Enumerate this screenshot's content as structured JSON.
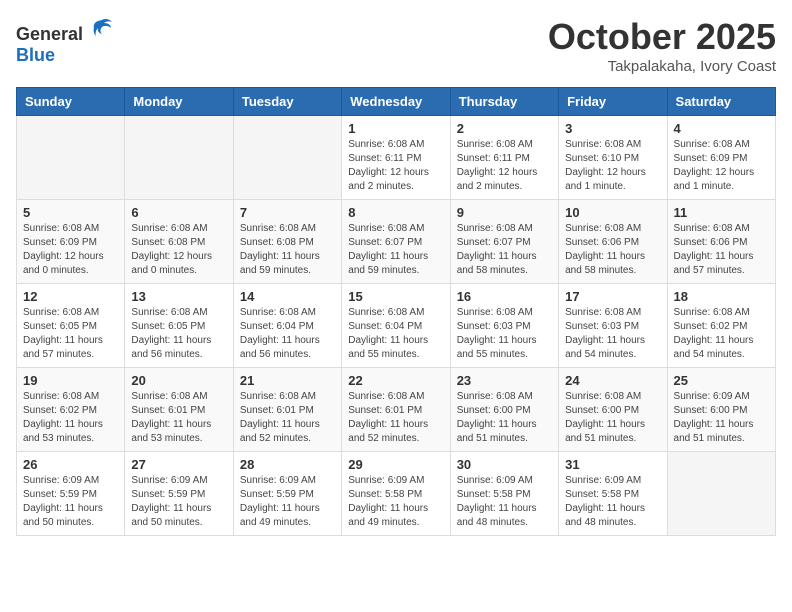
{
  "header": {
    "logo_general": "General",
    "logo_blue": "Blue",
    "month": "October 2025",
    "location": "Takpalakaha, Ivory Coast"
  },
  "weekdays": [
    "Sunday",
    "Monday",
    "Tuesday",
    "Wednesday",
    "Thursday",
    "Friday",
    "Saturday"
  ],
  "weeks": [
    [
      {
        "day": "",
        "info": ""
      },
      {
        "day": "",
        "info": ""
      },
      {
        "day": "",
        "info": ""
      },
      {
        "day": "1",
        "info": "Sunrise: 6:08 AM\nSunset: 6:11 PM\nDaylight: 12 hours and 2 minutes."
      },
      {
        "day": "2",
        "info": "Sunrise: 6:08 AM\nSunset: 6:11 PM\nDaylight: 12 hours and 2 minutes."
      },
      {
        "day": "3",
        "info": "Sunrise: 6:08 AM\nSunset: 6:10 PM\nDaylight: 12 hours and 1 minute."
      },
      {
        "day": "4",
        "info": "Sunrise: 6:08 AM\nSunset: 6:09 PM\nDaylight: 12 hours and 1 minute."
      }
    ],
    [
      {
        "day": "5",
        "info": "Sunrise: 6:08 AM\nSunset: 6:09 PM\nDaylight: 12 hours and 0 minutes."
      },
      {
        "day": "6",
        "info": "Sunrise: 6:08 AM\nSunset: 6:08 PM\nDaylight: 12 hours and 0 minutes."
      },
      {
        "day": "7",
        "info": "Sunrise: 6:08 AM\nSunset: 6:08 PM\nDaylight: 11 hours and 59 minutes."
      },
      {
        "day": "8",
        "info": "Sunrise: 6:08 AM\nSunset: 6:07 PM\nDaylight: 11 hours and 59 minutes."
      },
      {
        "day": "9",
        "info": "Sunrise: 6:08 AM\nSunset: 6:07 PM\nDaylight: 11 hours and 58 minutes."
      },
      {
        "day": "10",
        "info": "Sunrise: 6:08 AM\nSunset: 6:06 PM\nDaylight: 11 hours and 58 minutes."
      },
      {
        "day": "11",
        "info": "Sunrise: 6:08 AM\nSunset: 6:06 PM\nDaylight: 11 hours and 57 minutes."
      }
    ],
    [
      {
        "day": "12",
        "info": "Sunrise: 6:08 AM\nSunset: 6:05 PM\nDaylight: 11 hours and 57 minutes."
      },
      {
        "day": "13",
        "info": "Sunrise: 6:08 AM\nSunset: 6:05 PM\nDaylight: 11 hours and 56 minutes."
      },
      {
        "day": "14",
        "info": "Sunrise: 6:08 AM\nSunset: 6:04 PM\nDaylight: 11 hours and 56 minutes."
      },
      {
        "day": "15",
        "info": "Sunrise: 6:08 AM\nSunset: 6:04 PM\nDaylight: 11 hours and 55 minutes."
      },
      {
        "day": "16",
        "info": "Sunrise: 6:08 AM\nSunset: 6:03 PM\nDaylight: 11 hours and 55 minutes."
      },
      {
        "day": "17",
        "info": "Sunrise: 6:08 AM\nSunset: 6:03 PM\nDaylight: 11 hours and 54 minutes."
      },
      {
        "day": "18",
        "info": "Sunrise: 6:08 AM\nSunset: 6:02 PM\nDaylight: 11 hours and 54 minutes."
      }
    ],
    [
      {
        "day": "19",
        "info": "Sunrise: 6:08 AM\nSunset: 6:02 PM\nDaylight: 11 hours and 53 minutes."
      },
      {
        "day": "20",
        "info": "Sunrise: 6:08 AM\nSunset: 6:01 PM\nDaylight: 11 hours and 53 minutes."
      },
      {
        "day": "21",
        "info": "Sunrise: 6:08 AM\nSunset: 6:01 PM\nDaylight: 11 hours and 52 minutes."
      },
      {
        "day": "22",
        "info": "Sunrise: 6:08 AM\nSunset: 6:01 PM\nDaylight: 11 hours and 52 minutes."
      },
      {
        "day": "23",
        "info": "Sunrise: 6:08 AM\nSunset: 6:00 PM\nDaylight: 11 hours and 51 minutes."
      },
      {
        "day": "24",
        "info": "Sunrise: 6:08 AM\nSunset: 6:00 PM\nDaylight: 11 hours and 51 minutes."
      },
      {
        "day": "25",
        "info": "Sunrise: 6:09 AM\nSunset: 6:00 PM\nDaylight: 11 hours and 51 minutes."
      }
    ],
    [
      {
        "day": "26",
        "info": "Sunrise: 6:09 AM\nSunset: 5:59 PM\nDaylight: 11 hours and 50 minutes."
      },
      {
        "day": "27",
        "info": "Sunrise: 6:09 AM\nSunset: 5:59 PM\nDaylight: 11 hours and 50 minutes."
      },
      {
        "day": "28",
        "info": "Sunrise: 6:09 AM\nSunset: 5:59 PM\nDaylight: 11 hours and 49 minutes."
      },
      {
        "day": "29",
        "info": "Sunrise: 6:09 AM\nSunset: 5:58 PM\nDaylight: 11 hours and 49 minutes."
      },
      {
        "day": "30",
        "info": "Sunrise: 6:09 AM\nSunset: 5:58 PM\nDaylight: 11 hours and 48 minutes."
      },
      {
        "day": "31",
        "info": "Sunrise: 6:09 AM\nSunset: 5:58 PM\nDaylight: 11 hours and 48 minutes."
      },
      {
        "day": "",
        "info": ""
      }
    ]
  ]
}
